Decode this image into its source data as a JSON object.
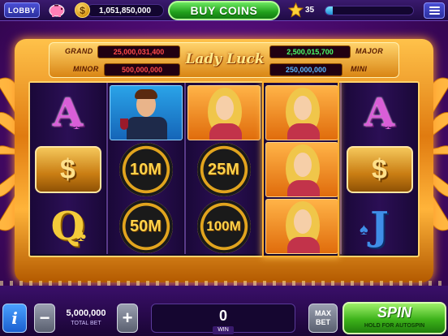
{
  "topbar": {
    "lobby_label": "LOBBY",
    "coin_symbol": "$",
    "coin_balance": "1,051,850,000",
    "buy_label": "BUY COINS",
    "level": "35",
    "level_progress": 0.08
  },
  "jackpots": {
    "grand_label": "GRAND",
    "grand_value": "25,000,031,400",
    "major_label": "MAJOR",
    "major_value": "2,500,015,700",
    "minor_label": "MINOR",
    "minor_value": "500,000,000",
    "mini_label": "MINI",
    "mini_value": "250,000,000",
    "logo_text": "Lady Luck"
  },
  "reels": [
    [
      "A",
      "$",
      "Q"
    ],
    [
      "man",
      "10M",
      "50M"
    ],
    [
      "lady",
      "25M",
      "100M"
    ],
    [
      "lady",
      "lady",
      "lady"
    ],
    [
      "A",
      "$",
      "J"
    ]
  ],
  "bottom": {
    "info_label": "i",
    "minus_label": "−",
    "plus_label": "+",
    "total_bet": "5,000,000",
    "total_bet_label": "TOTAL BET",
    "win_value": "0",
    "win_label": "WIN",
    "maxbet_label": "MAX BET",
    "spin_label": "SPIN",
    "spin_sub": "HOLD FOR AUTOSPIN"
  },
  "colors": {
    "accent_green": "#3db21a",
    "gold": "#ffc24a",
    "purple_bg": "#4a0a6e"
  }
}
